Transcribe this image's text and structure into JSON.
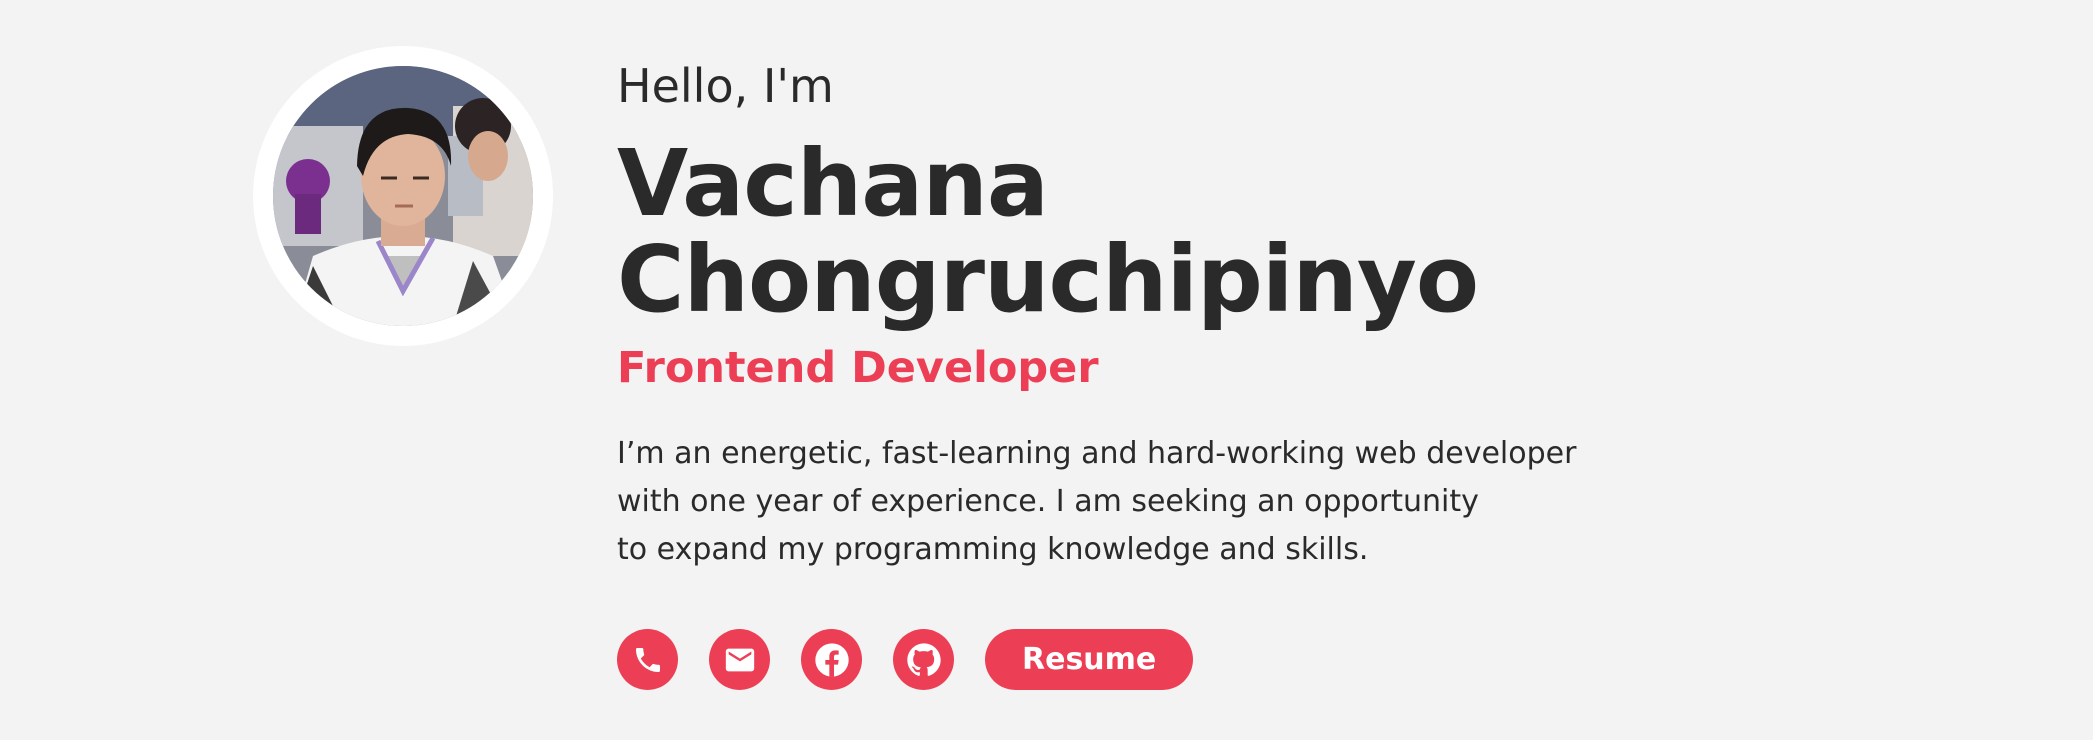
{
  "colors": {
    "background": "#f3f3f3",
    "accent": "#ec3f55",
    "text": "#2a2a2a"
  },
  "hero": {
    "greeting": "Hello, I'm",
    "name_first": "Vachana",
    "name_last": "Chongruchipinyo",
    "role": "Frontend Developer",
    "bio_lines": [
      "I’m an energetic, fast-learning and hard-working web developer",
      "with one year of experience. I am seeking an opportunity",
      "to expand my programming knowledge and skills."
    ]
  },
  "links": [
    {
      "icon": "phone-icon"
    },
    {
      "icon": "mail-icon"
    },
    {
      "icon": "facebook-icon"
    },
    {
      "icon": "github-icon"
    }
  ],
  "resume_label": "Resume"
}
